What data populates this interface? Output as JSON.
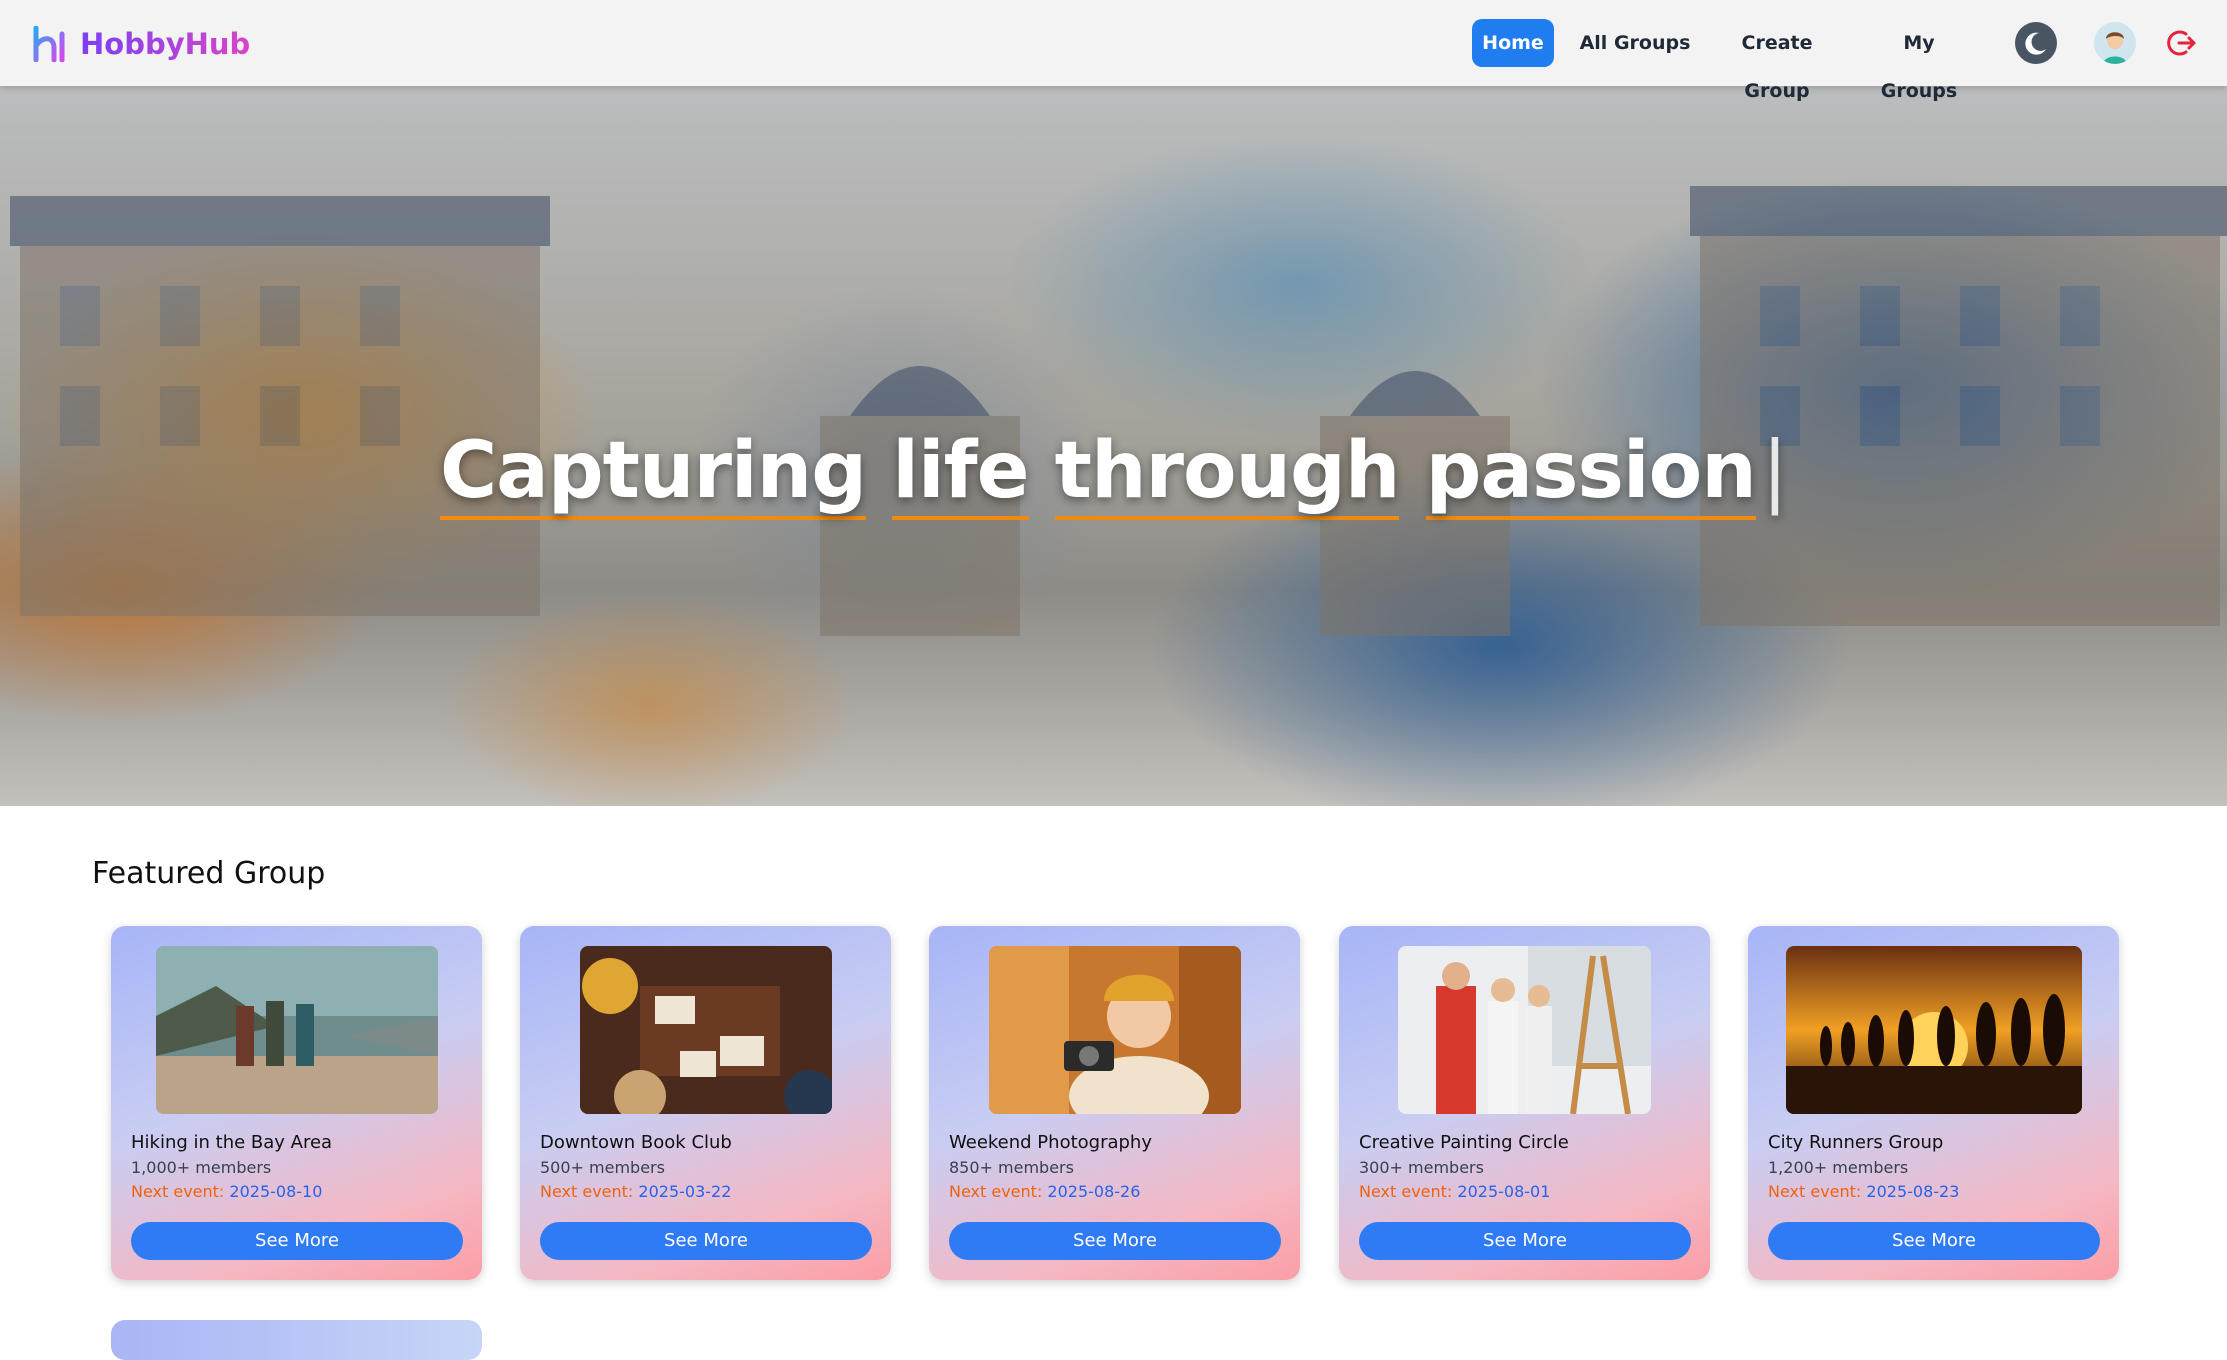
{
  "brand": {
    "name": "HobbyHub",
    "logo_icon": "hobbyhub-logo-icon"
  },
  "nav": {
    "links": [
      {
        "label": "Home",
        "active": true
      },
      {
        "label": "All Groups",
        "active": false
      },
      {
        "label": "Create Group",
        "active": false
      },
      {
        "label": "My Groups",
        "active": false
      }
    ],
    "theme_toggle_icon": "moon-icon",
    "avatar_icon": "user-avatar",
    "logout_icon": "logout-icon"
  },
  "hero": {
    "title_words": [
      "Capturing",
      "life",
      "through",
      "passion"
    ],
    "cursor": "|"
  },
  "featured": {
    "title": "Featured Group",
    "event_label": "Next event:",
    "button_label": "See More",
    "groups": [
      {
        "name": "Hiking in the Bay Area",
        "members": "1,000+ members",
        "next_event": "2025-08-10"
      },
      {
        "name": "Downtown Book Club",
        "members": "500+ members",
        "next_event": "2025-03-22"
      },
      {
        "name": "Weekend Photography",
        "members": "850+ members",
        "next_event": "2025-08-26"
      },
      {
        "name": "Creative Painting Circle",
        "members": "300+ members",
        "next_event": "2025-08-01"
      },
      {
        "name": "City Runners Group",
        "members": "1,200+ members",
        "next_event": "2025-08-23"
      }
    ]
  },
  "colors": {
    "primary": "#1f7df0",
    "button": "#2f7bf5",
    "event_label": "#f0620a",
    "event_date": "#2563eb",
    "underline": "#f08a10"
  }
}
